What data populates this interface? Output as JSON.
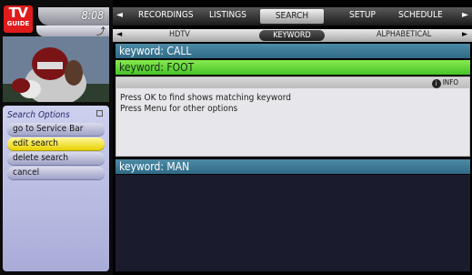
{
  "logo": {
    "line1": "TV",
    "line2": "GUIDE"
  },
  "clock": "8:08",
  "nav": {
    "left_arrow": "◄",
    "right_arrow": "►",
    "items": [
      "RECORDINGS",
      "LISTINGS",
      "SEARCH",
      "SETUP",
      "SCHEDULE"
    ],
    "active": "SEARCH"
  },
  "subnav": {
    "left_arrow": "◄",
    "right_arrow": "►",
    "items": [
      "HDTV",
      "KEYWORD",
      "ALPHABETICAL"
    ],
    "active": "KEYWORD"
  },
  "sidebar": {
    "title": "Search Options",
    "options": [
      {
        "label": "go to Service Bar",
        "selected": false
      },
      {
        "label": "edit search",
        "selected": true
      },
      {
        "label": "delete search",
        "selected": false
      },
      {
        "label": "cancel",
        "selected": false
      }
    ]
  },
  "keywords": [
    {
      "label": "keyword: CALL",
      "style": "teal"
    },
    {
      "label": "keyword: FOOT",
      "style": "green"
    },
    {
      "label": "keyword: MAN",
      "style": "teal"
    }
  ],
  "panel": {
    "info_label": "INFO",
    "info_icon": "i",
    "lines": [
      "Press OK to find shows matching keyword",
      "Press Menu for other options"
    ]
  },
  "colors": {
    "accent_green": "#47c32a",
    "teal": "#2f6a86",
    "highlight_yellow": "#e6d100",
    "logo_red": "#e01b1b"
  }
}
